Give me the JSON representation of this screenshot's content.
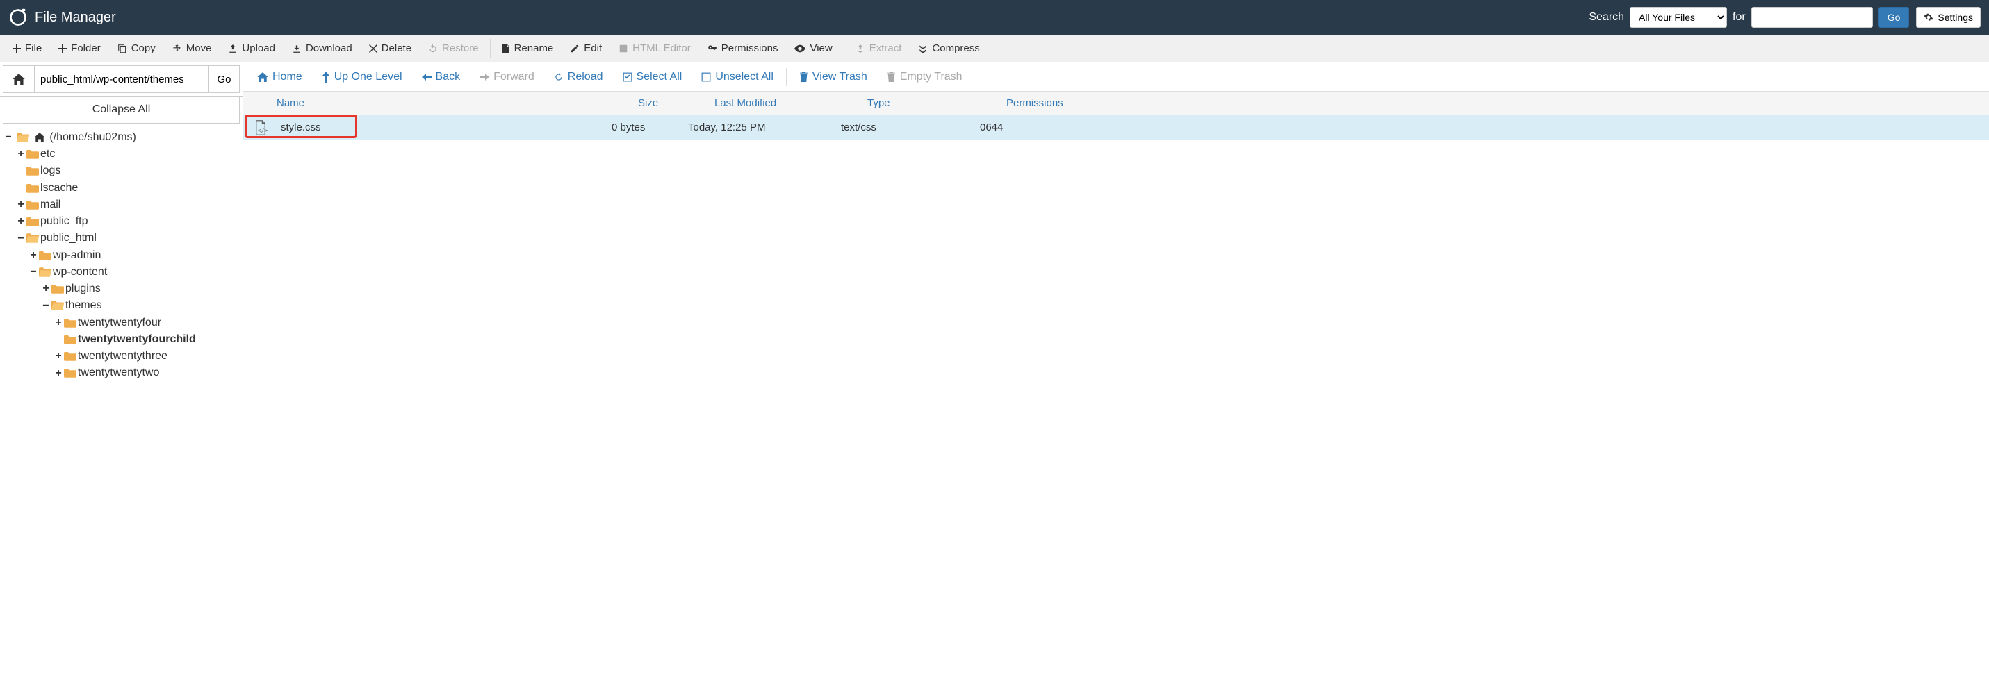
{
  "header": {
    "title": "File Manager",
    "search_label": "Search",
    "for_label": "for",
    "dropdown_selected": "All Your Files",
    "go_label": "Go",
    "settings_label": "Settings"
  },
  "toolbar": {
    "file": "File",
    "folder": "Folder",
    "copy": "Copy",
    "move": "Move",
    "upload": "Upload",
    "download": "Download",
    "delete": "Delete",
    "restore": "Restore",
    "rename": "Rename",
    "edit": "Edit",
    "html_editor": "HTML Editor",
    "permissions": "Permissions",
    "view": "View",
    "extract": "Extract",
    "compress": "Compress"
  },
  "path": {
    "value": "public_html/wp-content/themes",
    "go_label": "Go",
    "collapse_label": "Collapse All"
  },
  "tree": {
    "root_label": "(/home/shu02ms)",
    "items": [
      {
        "label": "etc",
        "depth": 1,
        "toggle": "+",
        "open": false
      },
      {
        "label": "logs",
        "depth": 1,
        "toggle": "",
        "open": false
      },
      {
        "label": "lscache",
        "depth": 1,
        "toggle": "",
        "open": false
      },
      {
        "label": "mail",
        "depth": 1,
        "toggle": "+",
        "open": false
      },
      {
        "label": "public_ftp",
        "depth": 1,
        "toggle": "+",
        "open": false
      },
      {
        "label": "public_html",
        "depth": 1,
        "toggle": "−",
        "open": true
      },
      {
        "label": "wp-admin",
        "depth": 2,
        "toggle": "+",
        "open": false
      },
      {
        "label": "wp-content",
        "depth": 2,
        "toggle": "−",
        "open": true
      },
      {
        "label": "plugins",
        "depth": 3,
        "toggle": "+",
        "open": false
      },
      {
        "label": "themes",
        "depth": 3,
        "toggle": "−",
        "open": true
      },
      {
        "label": "twentytwentyfour",
        "depth": 4,
        "toggle": "+",
        "open": false
      },
      {
        "label": "twentytwentyfourchild",
        "depth": 4,
        "toggle": "",
        "open": false,
        "bold": true
      },
      {
        "label": "twentytwentythree",
        "depth": 4,
        "toggle": "+",
        "open": false
      },
      {
        "label": "twentytwentytwo",
        "depth": 4,
        "toggle": "+",
        "open": false
      }
    ]
  },
  "nav": {
    "home": "Home",
    "up": "Up One Level",
    "back": "Back",
    "forward": "Forward",
    "reload": "Reload",
    "select_all": "Select All",
    "unselect_all": "Unselect All",
    "view_trash": "View Trash",
    "empty_trash": "Empty Trash"
  },
  "table": {
    "headers": {
      "name": "Name",
      "size": "Size",
      "modified": "Last Modified",
      "type": "Type",
      "permissions": "Permissions"
    },
    "rows": [
      {
        "name": "style.css",
        "size": "0 bytes",
        "modified": "Today, 12:25 PM",
        "type": "text/css",
        "permissions": "0644"
      }
    ]
  }
}
